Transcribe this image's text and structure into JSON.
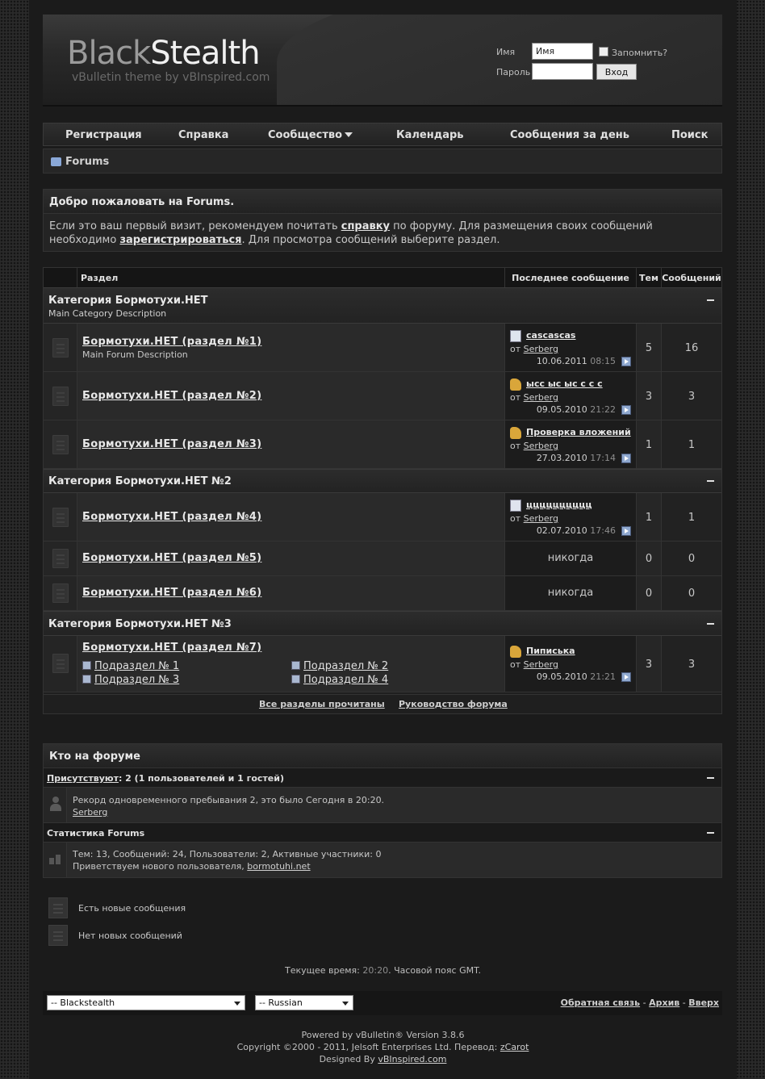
{
  "header": {
    "logo_part1": "Black",
    "logo_part2": "Stealth",
    "logo_sub": "vBulletin theme by vBInspired.com",
    "login": {
      "user_label": "Имя",
      "user_value": "Имя",
      "remember_label": "Запомнить?",
      "pass_label": "Пароль",
      "pass_value": "",
      "button": "Вход"
    }
  },
  "navbar": {
    "items": [
      "Регистрация",
      "Справка",
      "Сообщество",
      "Календарь",
      "Сообщения за день",
      "Поиск"
    ]
  },
  "breadcrumb": "Forums",
  "welcome": {
    "title": "Добро пожаловать на Forums.",
    "text1": "Если это ваш первый визит, рекомендуем почитать ",
    "link1": "справку",
    "text2": " по форуму. Для размещения своих сообщений",
    "text3": "необходимо ",
    "link2": "зарегистрироваться",
    "text4": ". Для просмотра сообщений выберите раздел."
  },
  "forum_table": {
    "columns": [
      "Раздел",
      "Последнее сообщение",
      "Тем",
      "Сообщений"
    ],
    "categories": [
      {
        "title": "Категория Бормотухи.НЕТ",
        "desc": "Main Category Description",
        "forums": [
          {
            "title": "Бормотухи.НЕТ (раздел №1)",
            "desc": "Main Forum Description",
            "last_title": "cascascas",
            "last_icon": "document-icon",
            "last_by": "от ",
            "last_user": "Serberg",
            "last_date": "10.06.2011",
            "last_time": "08:15",
            "threads": "5",
            "posts": "16"
          },
          {
            "title": "Бормотухи.НЕТ (раздел №2)",
            "desc": "",
            "last_title": "ысс ыс ыс с с с",
            "last_icon": "thumbs-up-icon",
            "last_by": "от ",
            "last_user": "Serberg",
            "last_date": "09.05.2010",
            "last_time": "21:22",
            "threads": "3",
            "posts": "3"
          },
          {
            "title": "Бормотухи.НЕТ (раздел №3)",
            "desc": "",
            "last_title": "Проверка вложений",
            "last_icon": "thumbs-up-icon",
            "last_by": "от ",
            "last_user": "Serberg",
            "last_date": "27.03.2010",
            "last_time": "17:14",
            "threads": "1",
            "posts": "1"
          }
        ]
      },
      {
        "title": "Категория Бормотухи.НЕТ №2",
        "desc": "",
        "forums": [
          {
            "title": "Бормотухи.НЕТ (раздел №4)",
            "desc": "",
            "last_title": "цццццццццц",
            "last_icon": "document-icon",
            "last_by": "от ",
            "last_user": "Serberg",
            "last_date": "02.07.2010",
            "last_time": "17:46",
            "threads": "1",
            "posts": "1"
          },
          {
            "title": "Бормотухи.НЕТ (раздел №5)",
            "never": "никогда",
            "threads": "0",
            "posts": "0"
          },
          {
            "title": "Бормотухи.НЕТ (раздел №6)",
            "never": "никогда",
            "threads": "0",
            "posts": "0"
          }
        ]
      },
      {
        "title": "Категория Бормотухи.НЕТ №3",
        "desc": "",
        "forums": [
          {
            "title": "Бормотухи.НЕТ (раздел №7)",
            "subforums": [
              "Подраздел № 1",
              "Подраздел № 2",
              "Подраздел № 3",
              "Подраздел № 4"
            ],
            "last_title": "Пиписька",
            "last_icon": "thumbs-up-icon",
            "last_by": "от ",
            "last_user": "Serberg",
            "last_date": "09.05.2010",
            "last_time": "21:21",
            "threads": "3",
            "posts": "3"
          }
        ]
      }
    ],
    "footer_links": [
      "Все разделы прочитаны",
      "Руководство форума"
    ]
  },
  "online": {
    "title": "Кто на форуме",
    "present_link": "Присутствуют",
    "present_text": ": 2 (1 пользователей и 1 гостей)",
    "record": "Рекорд одновременного пребывания 2, это было Сегодня в 20:20.",
    "user": "Serberg",
    "stats_title": "Статистика Forums",
    "stats": "Тем: 13, Сообщений: 24, Пользователи: 2, Активные участники: 0",
    "welcome_text": "Приветствуем нового пользователя, ",
    "new_user": "bormotuhi.net"
  },
  "legend": {
    "new_posts": "Есть новые сообщения",
    "no_new_posts": "Нет новых сообщений"
  },
  "current_time": {
    "label": "Текущее время: ",
    "time": "20:20",
    "tz": ". Часовой пояс GMT."
  },
  "footer": {
    "style_select": "-- Blackstealth",
    "lang_select": "-- Russian",
    "links": [
      "Обратная связь",
      "Архив",
      "Вверх"
    ],
    "sep": " - "
  },
  "copyright": {
    "line1": "Powered by vBulletin® Version 3.8.6",
    "line2": "Copyright ©2000 - 2011, Jelsoft Enterprises Ltd. Перевод: ",
    "translator": "zCarot",
    "line3": "Designed By ",
    "designer": "vBInspired.com"
  }
}
